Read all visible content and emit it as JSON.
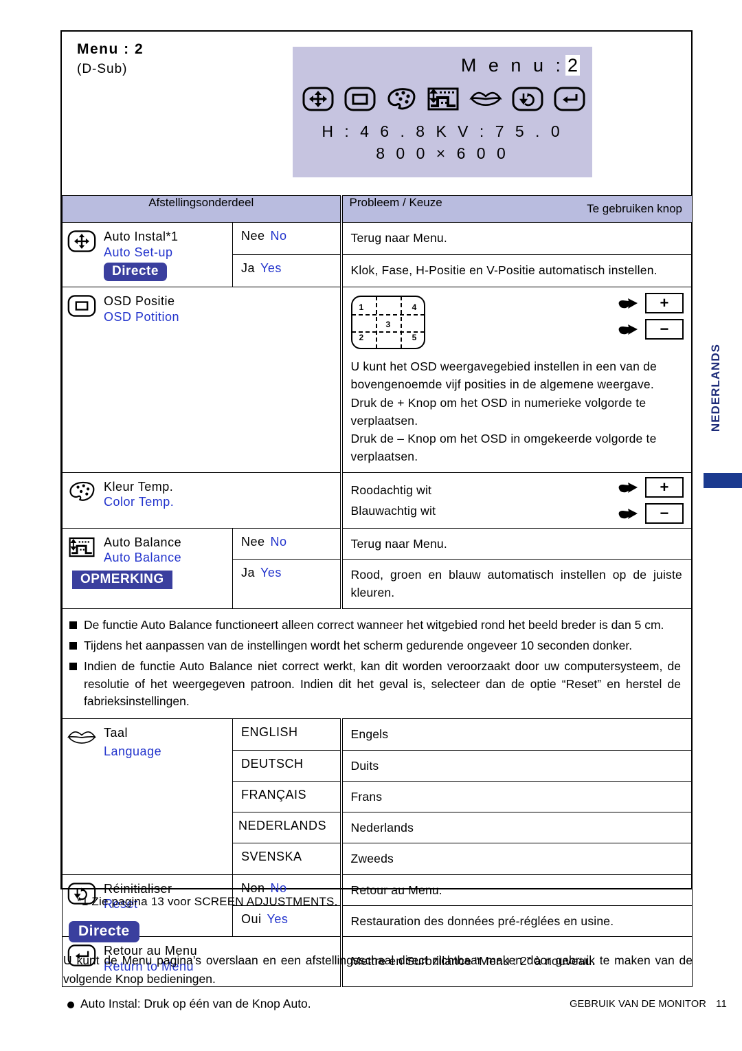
{
  "header": {
    "menu_title": "Menu : 2",
    "menu_sub": "(D-Sub)"
  },
  "osd": {
    "title_label": "M e n u :",
    "title_value": "2",
    "freq_line": "H : 4 6 . 8 K    V : 7 5 . 0",
    "res_line": "8 0 0   ×   6 0 0",
    "icons": [
      "auto-setup-icon",
      "osd-position-icon",
      "color-temp-icon",
      "auto-balance-icon",
      "language-icon",
      "reset-icon",
      "return-icon"
    ],
    "bg_color": "#C6C4E0"
  },
  "table": {
    "headers": {
      "adjustment": "Afstellingsonderdeel",
      "problem": "Probleem / Keuze",
      "button": "Te gebruiken knop"
    },
    "rows": [
      {
        "icon": "auto-setup-icon",
        "name_nl": "Auto Instal*1",
        "name_en": "Auto Set-up",
        "badge": "Directe",
        "choices": [
          {
            "nl": "Nee",
            "en": "No",
            "desc": "Terug naar Menu."
          },
          {
            "nl": "Ja",
            "en": "Yes",
            "desc": "Klok, Fase, H-Positie en V-Positie automatisch instellen."
          }
        ]
      },
      {
        "icon": "osd-position-icon",
        "name_nl": "OSD Positie",
        "name_en": "OSD Potition",
        "diagram_numbers": [
          "1",
          "4",
          "3",
          "2",
          "5"
        ],
        "buttons": [
          "+",
          "−"
        ],
        "desc_lines": [
          "U kunt het OSD weergavegebied instellen in een van de bovengenoemde vijf posities in de algemene weergave.",
          "Druk de + Knop om het OSD in numerieke volgorde te verplaatsen.",
          "Druk de – Knop om het OSD in omgekeerde volgorde te verplaatsen."
        ]
      },
      {
        "icon": "color-temp-icon",
        "name_nl": "Kleur Temp.",
        "name_en": "Color Temp.",
        "choices": [
          {
            "desc": "Roodachtig wit",
            "key": "+"
          },
          {
            "desc": "Blauwachtig wit",
            "key": "−"
          }
        ]
      },
      {
        "icon": "auto-balance-icon",
        "name_nl": "Auto Balance",
        "name_en": "Auto Balance",
        "badge": "OPMERKING",
        "choices": [
          {
            "nl": "Nee",
            "en": "No",
            "desc": "Terug naar Menu."
          },
          {
            "nl": "Ja",
            "en": "Yes",
            "desc": "Rood, groen en blauw automatisch instellen op de juiste kleuren."
          }
        ]
      }
    ],
    "notes": [
      "De functie Auto Balance functioneert alleen correct wanneer het witgebied rond het beeld breder is dan 5 cm.",
      "Tijdens het aanpassen van de instellingen wordt het scherm gedurende ongeveer 10 seconden donker.",
      "Indien de functie Auto Balance niet correct werkt, kan dit worden veroorzaakt door uw computersysteem, de resolutie of het weergegeven patroon. Indien dit het geval is, selecteer dan de optie “Reset” en herstel de fabrieksinstellingen."
    ],
    "language_row": {
      "icon": "language-icon",
      "name_nl": "Taal",
      "name_en": "Language",
      "options": [
        {
          "value": "ENGLISH",
          "desc": "Engels"
        },
        {
          "value": "DEUTSCH",
          "desc": "Duits"
        },
        {
          "value": "FRANÇAIS",
          "desc": "Frans"
        },
        {
          "value": "NEDERLANDS",
          "desc": "Nederlands"
        },
        {
          "value": "SVENSKA",
          "desc": "Zweeds"
        }
      ]
    },
    "reset_row": {
      "icon": "reset-icon",
      "name_nl": "Réinitialiser",
      "name_en": "Reset",
      "choices": [
        {
          "nl": "Non",
          "en": "No",
          "desc": "Retour au Menu."
        },
        {
          "nl": "Oui",
          "en": "Yes",
          "desc": "Restauration des données pré-réglées en usine."
        }
      ]
    },
    "return_row": {
      "icon": "return-icon",
      "name_nl": "Retour au Menu",
      "name_en": "Return to Menu",
      "desc": "Mettre en Surbrillance “Menu : 2” à nouveau."
    }
  },
  "footnote": "*1  Zie pagina 13 voor SCREEN ADJUSTMENTS.",
  "direct": {
    "badge": "Directe",
    "paragraph": "U kunt de Menu pagina’s overslaan en een afstellingsschaal direct zichtbaar maken door gebruik te maken van de volgende Knop bedieningen.",
    "bullet": "Auto Instal: Druk op één van de Knop Auto."
  },
  "footer": {
    "text": "GEBRUIK VAN DE MONITOR",
    "page": "11"
  },
  "sidetab": {
    "label": "NEDERLANDS",
    "color": "#1B2A78"
  },
  "colors": {
    "osd_bg": "#C6C4E0",
    "table_header": "#B9BCDF",
    "badge_blue": "#3A3F9E",
    "link_blue": "#2233CC"
  }
}
